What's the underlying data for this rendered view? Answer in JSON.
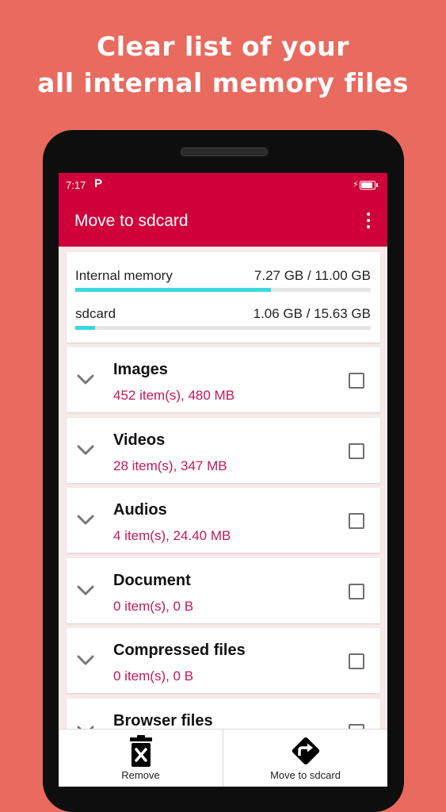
{
  "promo": {
    "line1": "Clear list of  your",
    "line2": "all internal memory files"
  },
  "status_bar": {
    "time": "7:17",
    "notification": "P"
  },
  "app_bar": {
    "title": "Move to sdcard"
  },
  "storage": [
    {
      "name": "Internal memory",
      "usage": "7.27 GB / 11.00 GB",
      "fill": 0.661
    },
    {
      "name": "sdcard",
      "usage": "1.06 GB / 15.63 GB",
      "fill": 0.068
    }
  ],
  "categories": [
    {
      "name": "Images",
      "detail": "452 item(s), 480 MB"
    },
    {
      "name": "Videos",
      "detail": "28 item(s), 347 MB"
    },
    {
      "name": "Audios",
      "detail": "4 item(s), 24.40 MB"
    },
    {
      "name": "Document",
      "detail": "0 item(s), 0 B"
    },
    {
      "name": "Compressed files",
      "detail": "0 item(s), 0 B"
    },
    {
      "name": "Browser files",
      "detail": ""
    }
  ],
  "actions": {
    "remove_label": "Remove",
    "move_label": "Move to sdcard"
  },
  "colors": {
    "background": "#e96a5e",
    "accent": "#d0003a",
    "progress": "#3bd8df",
    "detail_text": "#c2185b"
  },
  "icons": {
    "expand": "chevron-down-icon",
    "remove": "trash-delete-icon",
    "move": "turn-right-arrow-diamond-icon",
    "menu": "more-vertical-icon"
  }
}
